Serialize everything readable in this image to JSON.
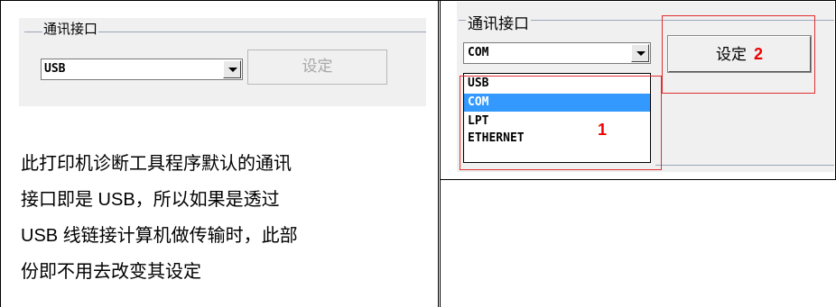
{
  "left_panel": {
    "group_title": "通讯接口",
    "combo_value": "USB",
    "set_button_label": "设定",
    "description_lines": [
      "此打印机诊断工具程序默认的通讯",
      "接口即是 USB，所以如果是透过",
      "USB 线链接计算机做传输时，此部",
      "份即不用去改变其设定"
    ]
  },
  "right_panel": {
    "group_title": "通讯接口",
    "combo_value": "COM",
    "set_button_label": "设定",
    "set_button_marker": "2",
    "dropdown_options": [
      "USB",
      "COM",
      "LPT",
      "ETHERNET"
    ],
    "selected_option": "COM",
    "list_marker": "1"
  },
  "colors": {
    "annotation_red": "#e00000",
    "selection_blue": "#3399ff"
  }
}
